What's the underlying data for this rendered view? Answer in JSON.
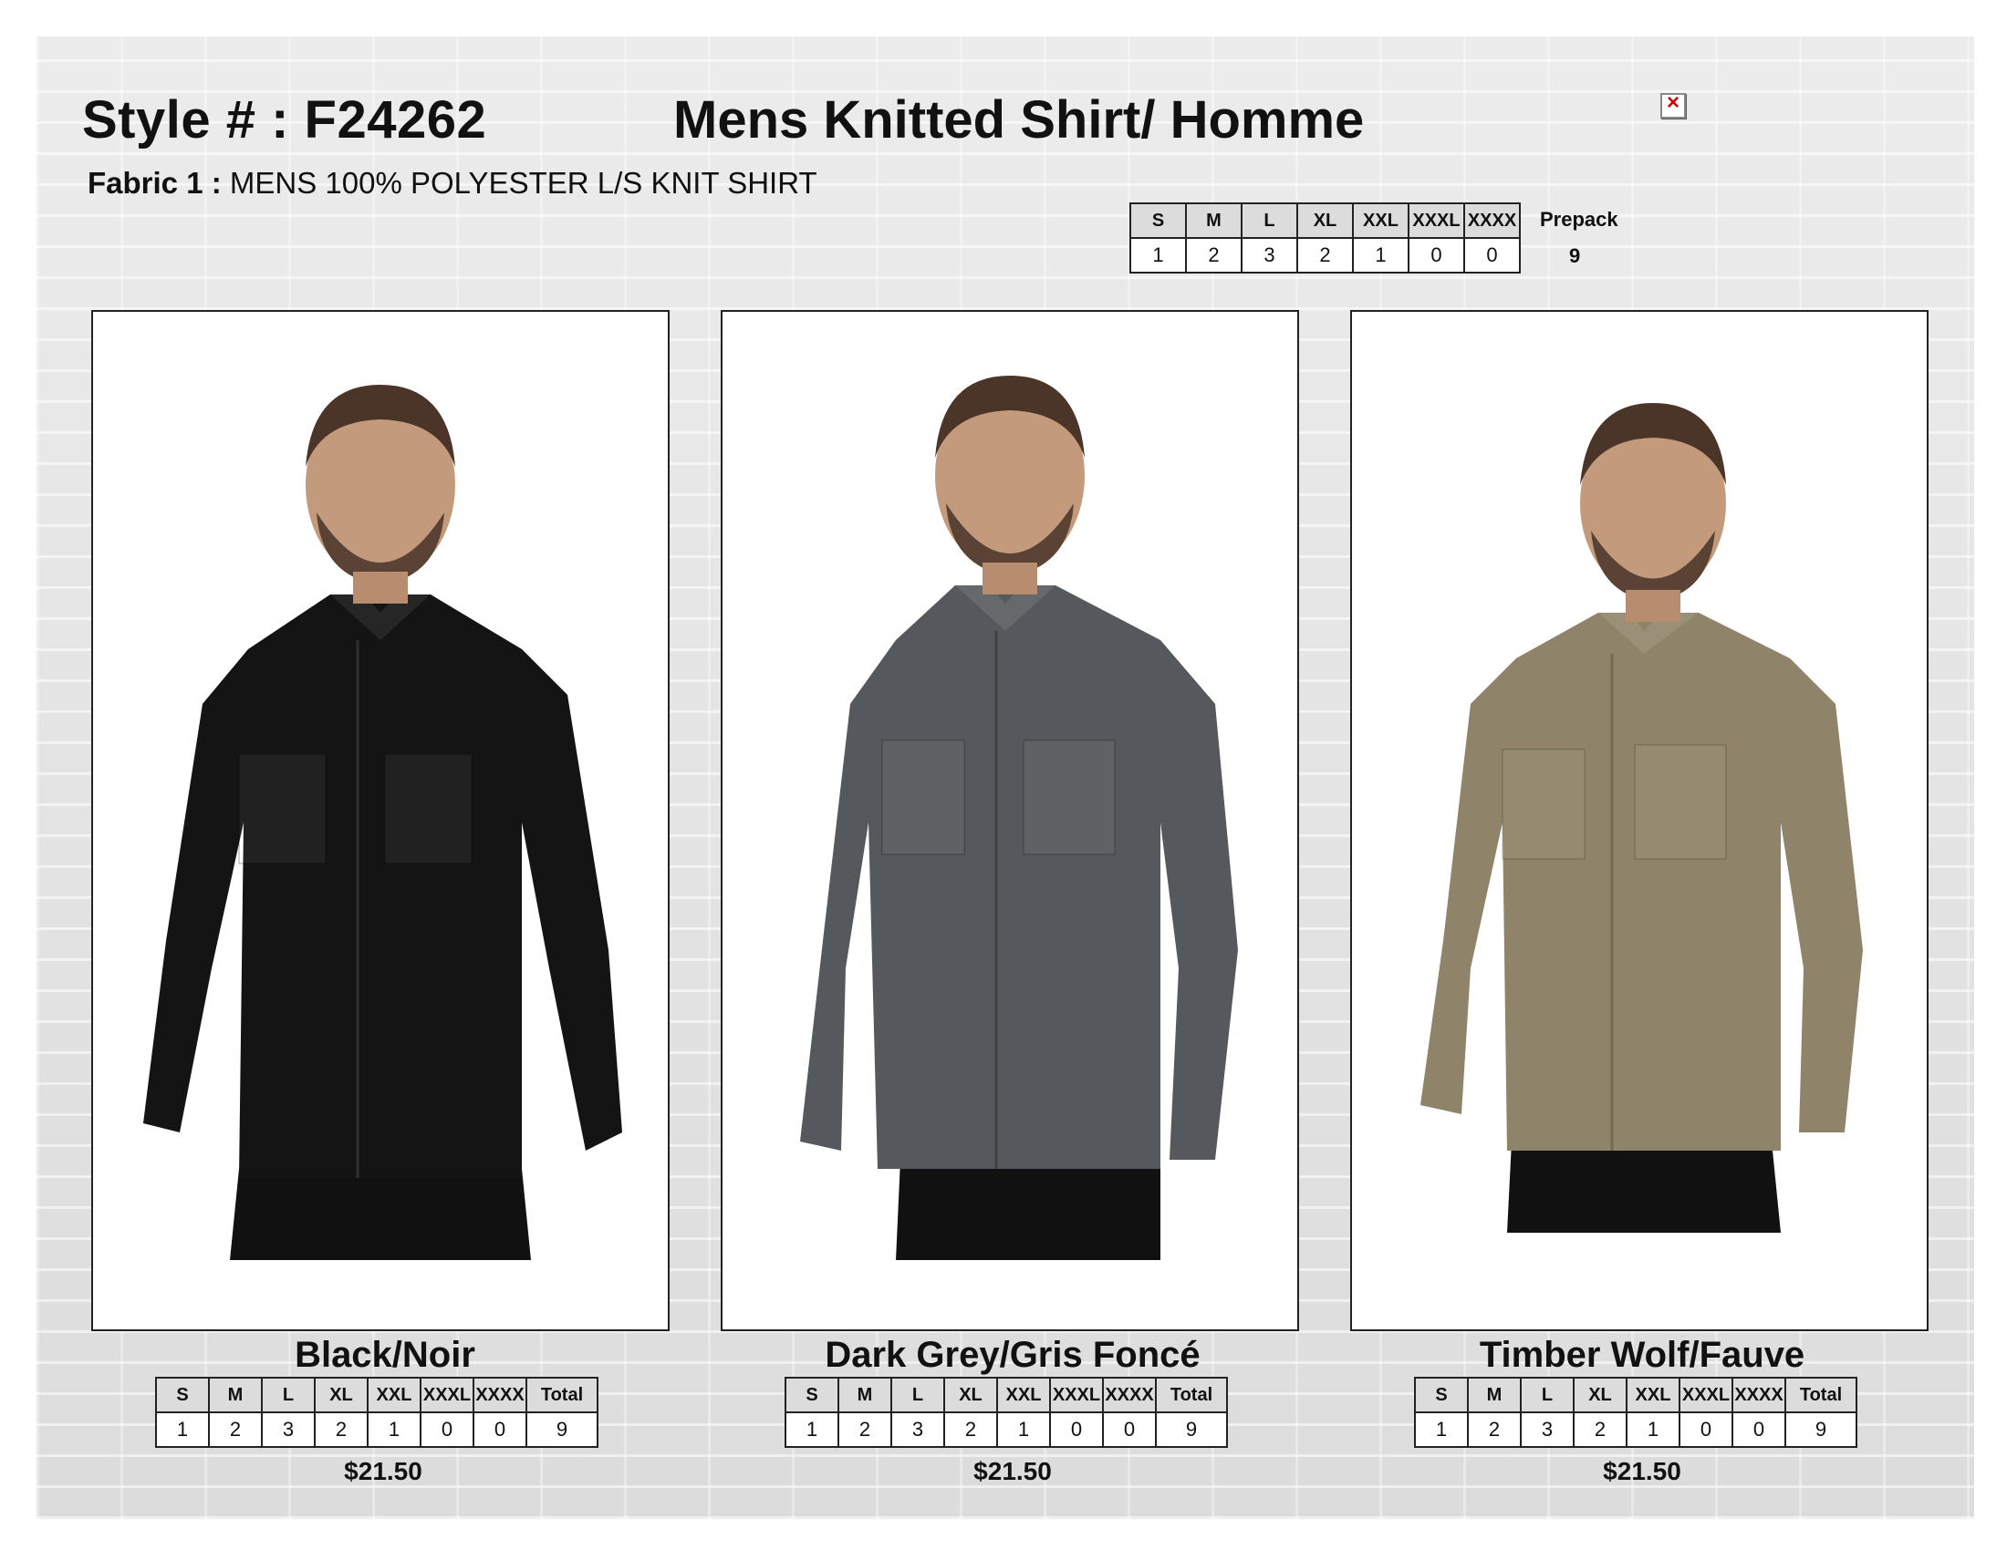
{
  "header": {
    "style_number": "Style # : F24262",
    "title": "Mens Knitted Shirt/ Homme",
    "fabric_label": "Fabric 1 :",
    "fabric_value": "MENS 100% POLYESTER L/S KNIT SHIRT"
  },
  "sizes": [
    "S",
    "M",
    "L",
    "XL",
    "XXL",
    "XXXL",
    "XXXX"
  ],
  "prepack": {
    "label": "Prepack",
    "quantities": [
      "1",
      "2",
      "3",
      "2",
      "1",
      "0",
      "0"
    ],
    "total": "9"
  },
  "total_label": "Total",
  "products": [
    {
      "color_name": "Black/Noir",
      "shirt_color": "#141414",
      "quantities": [
        "1",
        "2",
        "3",
        "2",
        "1",
        "0",
        "0"
      ],
      "total": "9",
      "price": "$21.50"
    },
    {
      "color_name": "Dark Grey/Gris Foncé",
      "shirt_color": "#55585c",
      "quantities": [
        "1",
        "2",
        "3",
        "2",
        "1",
        "0",
        "0"
      ],
      "total": "9",
      "price": "$21.50"
    },
    {
      "color_name": "Timber Wolf/Fauve",
      "shirt_color": "#8f8469",
      "quantities": [
        "1",
        "2",
        "3",
        "2",
        "1",
        "0",
        "0"
      ],
      "total": "9",
      "price": "$21.50"
    }
  ]
}
